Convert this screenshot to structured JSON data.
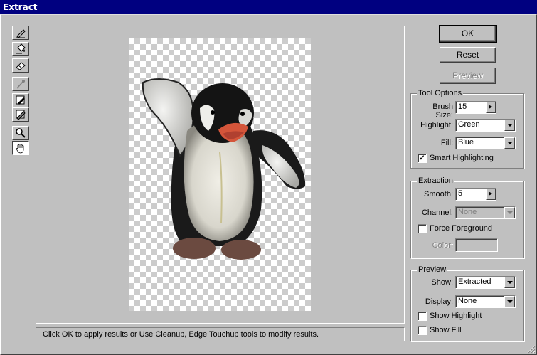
{
  "window": {
    "title": "Extract"
  },
  "tools": [
    {
      "name": "edge-highlighter-icon"
    },
    {
      "name": "fill-bucket-icon"
    },
    {
      "name": "eraser-icon"
    },
    {
      "name": "eyedropper-icon"
    },
    {
      "name": "cleanup-tool-icon"
    },
    {
      "name": "edge-touchup-icon"
    },
    {
      "name": "zoom-icon"
    },
    {
      "name": "hand-icon"
    }
  ],
  "status": {
    "message": "Click OK to apply results or Use Cleanup, Edge Touchup tools to modify results."
  },
  "buttons": {
    "ok": "OK",
    "reset": "Reset",
    "preview": "Preview"
  },
  "tool_options": {
    "title": "Tool Options",
    "brush_size_label": "Brush Size:",
    "brush_size_value": "15",
    "highlight_label": "Highlight:",
    "highlight_value": "Green",
    "fill_label": "Fill:",
    "fill_value": "Blue",
    "smart_highlighting_label": "Smart Highlighting",
    "smart_highlighting_checked": "✓"
  },
  "extraction": {
    "title": "Extraction",
    "smooth_label": "Smooth:",
    "smooth_value": "5",
    "channel_label": "Channel:",
    "channel_value": "None",
    "force_foreground_label": "Force Foreground",
    "color_label": "Color:"
  },
  "preview": {
    "title": "Preview",
    "show_label": "Show:",
    "show_value": "Extracted",
    "display_label": "Display:",
    "display_value": "None",
    "show_highlight_label": "Show Highlight",
    "show_fill_label": "Show Fill"
  },
  "colors": {
    "titlebar": "#000080",
    "face": "#c0c0c0"
  }
}
